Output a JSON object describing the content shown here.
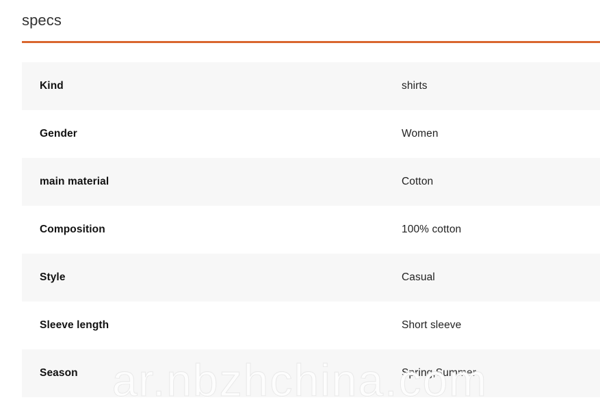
{
  "header": {
    "title": "specs",
    "rule_color": "#d9662e"
  },
  "table": {
    "rows": [
      {
        "label": "Kind",
        "value": "shirts"
      },
      {
        "label": "Gender",
        "value": "Women"
      },
      {
        "label": "main material",
        "value": "Cotton"
      },
      {
        "label": "Composition",
        "value": "100% cotton"
      },
      {
        "label": "Style",
        "value": "Casual"
      },
      {
        "label": "Sleeve length",
        "value": "Short sleeve"
      },
      {
        "label": "Season",
        "value": "Spring,Summer"
      }
    ],
    "shaded_row_color": "#f7f7f7",
    "plain_row_color": "#ffffff"
  },
  "watermark": {
    "text": "ar.nbzhchina.com",
    "color": "#e9e9e9"
  }
}
